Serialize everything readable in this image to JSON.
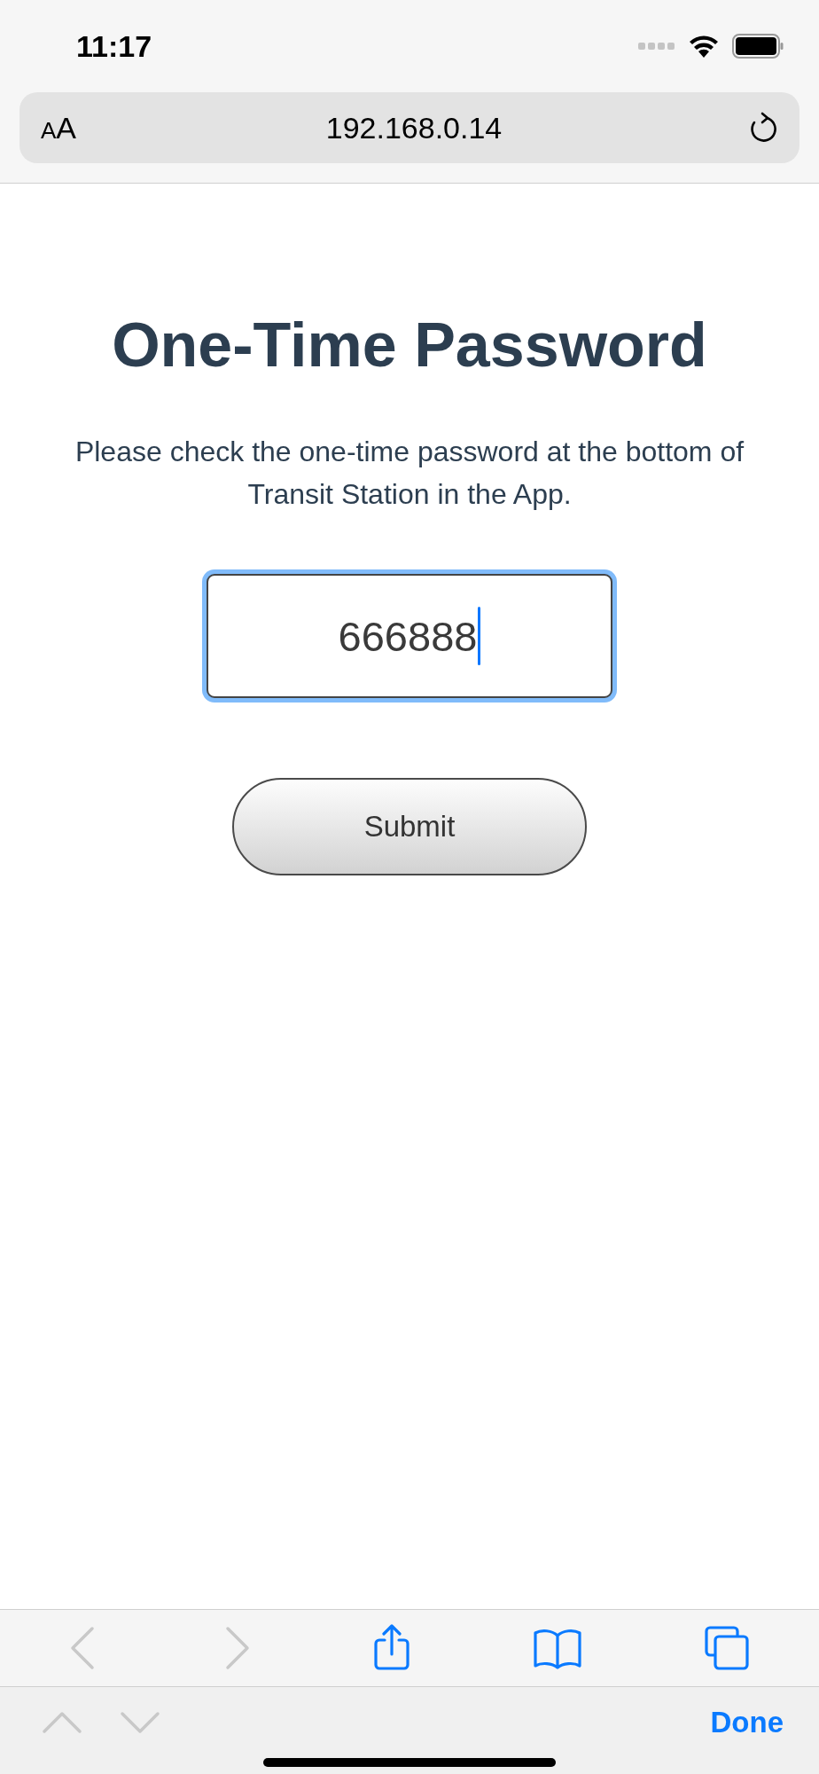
{
  "status_bar": {
    "time": "11:17"
  },
  "address_bar": {
    "format_letters": [
      "A",
      "A"
    ],
    "url": "192.168.0.14"
  },
  "page": {
    "title": "One-Time Password",
    "instructions": "Please check the one-time password at the bottom of Transit Station in the App.",
    "otp_field": {
      "value": "666888",
      "focused": true
    },
    "submit_button": "Submit"
  },
  "toolbar": {
    "back_disabled": true,
    "forward_disabled": true
  },
  "find_bar": {
    "previous_disabled": true,
    "next_disabled": true,
    "done": "Done"
  }
}
